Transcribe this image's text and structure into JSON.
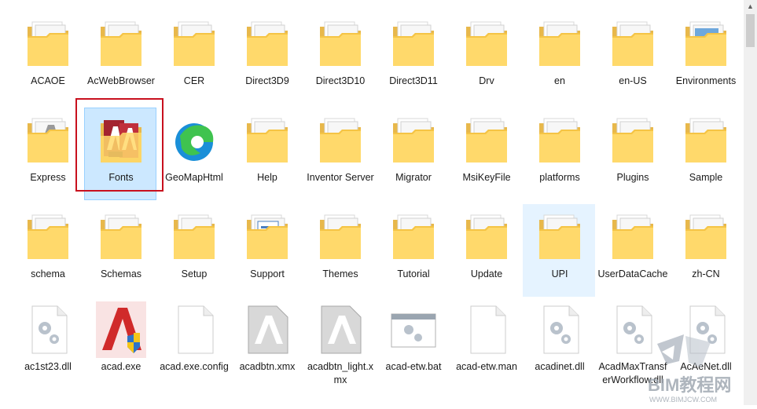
{
  "items": [
    {
      "label": "ACAOE",
      "kind": "folder"
    },
    {
      "label": "AcWebBrowser",
      "kind": "folder-gear"
    },
    {
      "label": "CER",
      "kind": "folder"
    },
    {
      "label": "Direct3D9",
      "kind": "folder"
    },
    {
      "label": "Direct3D10",
      "kind": "folder"
    },
    {
      "label": "Direct3D11",
      "kind": "folder"
    },
    {
      "label": "Drv",
      "kind": "folder-dark"
    },
    {
      "label": "en",
      "kind": "folder"
    },
    {
      "label": "en-US",
      "kind": "folder-gear"
    },
    {
      "label": "Environments",
      "kind": "folder-pic"
    },
    {
      "label": "Express",
      "kind": "folder-a"
    },
    {
      "label": "Fonts",
      "kind": "folder-fonts",
      "selected": true
    },
    {
      "label": "GeoMapHtml",
      "kind": "edge"
    },
    {
      "label": "Help",
      "kind": "folder"
    },
    {
      "label": "Inventor Server",
      "kind": "folder"
    },
    {
      "label": "Migrator",
      "kind": "folder"
    },
    {
      "label": "MsiKeyFile",
      "kind": "folder-gear"
    },
    {
      "label": "platforms",
      "kind": "folder-gear"
    },
    {
      "label": "Plugins",
      "kind": "folder"
    },
    {
      "label": "Sample",
      "kind": "folder"
    },
    {
      "label": "schema",
      "kind": "folder"
    },
    {
      "label": "Schemas",
      "kind": "folder"
    },
    {
      "label": "Setup",
      "kind": "folder-gear"
    },
    {
      "label": "Support",
      "kind": "folder-doc"
    },
    {
      "label": "Themes",
      "kind": "folder"
    },
    {
      "label": "Tutorial",
      "kind": "folder"
    },
    {
      "label": "Update",
      "kind": "folder-gear"
    },
    {
      "label": "UPI",
      "kind": "folder",
      "hover": true
    },
    {
      "label": "UserDataCache",
      "kind": "folder"
    },
    {
      "label": "zh-CN",
      "kind": "folder"
    },
    {
      "label": "ac1st23.dll",
      "kind": "dll"
    },
    {
      "label": "acad.exe",
      "kind": "acad"
    },
    {
      "label": "acad.exe.config",
      "kind": "blank"
    },
    {
      "label": "acadbtn.xmx",
      "kind": "xmx"
    },
    {
      "label": "acadbtn_light.xmx",
      "kind": "xmx"
    },
    {
      "label": "acad-etw.bat",
      "kind": "bat"
    },
    {
      "label": "acad-etw.man",
      "kind": "blank"
    },
    {
      "label": "acadinet.dll",
      "kind": "dll"
    },
    {
      "label": "AcadMaxTransferWorkflow.dll",
      "kind": "dll"
    },
    {
      "label": "AcAeNet.dll",
      "kind": "dll"
    }
  ],
  "watermark": {
    "line1": "BIM教程网",
    "line2": "WWW.BIMJCW.COM"
  }
}
